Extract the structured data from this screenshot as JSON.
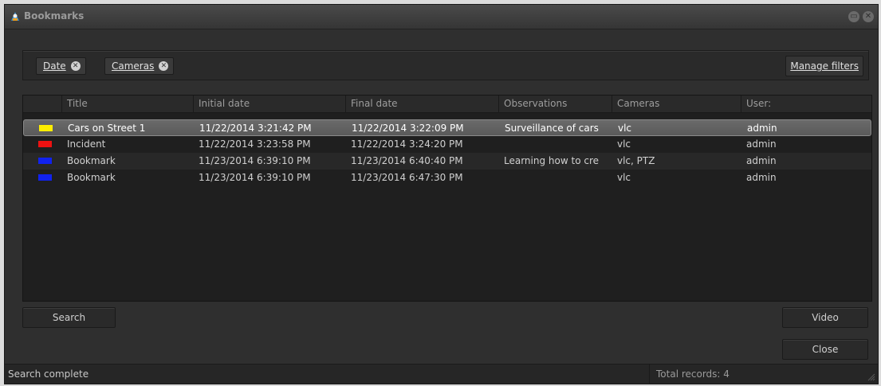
{
  "window": {
    "title": "Bookmarks"
  },
  "filters": {
    "chips": [
      {
        "label": "Date"
      },
      {
        "label": "Cameras"
      }
    ],
    "manage_label": "Manage filters"
  },
  "table": {
    "columns": [
      "",
      "Title",
      "Initial date",
      "Final date",
      "Observations",
      "Cameras",
      "User:"
    ],
    "rows": [
      {
        "color": "#ffee00",
        "title": "Cars on Street 1",
        "initial": "11/22/2014 3:21:42 PM",
        "final": "11/22/2014 3:22:09 PM",
        "observations": "Surveillance of cars",
        "cameras": "vlc",
        "user": "admin"
      },
      {
        "color": "#ee1111",
        "title": "Incident",
        "initial": "11/22/2014 3:23:58 PM",
        "final": "11/22/2014 3:24:20 PM",
        "observations": "",
        "cameras": "vlc",
        "user": "admin"
      },
      {
        "color": "#1122ee",
        "title": "Bookmark",
        "initial": "11/23/2014 6:39:10 PM",
        "final": "11/23/2014 6:40:40 PM",
        "observations": "Learning how to cre",
        "cameras": "vlc, PTZ",
        "user": "admin"
      },
      {
        "color": "#1122ee",
        "title": "Bookmark",
        "initial": "11/23/2014 6:39:10 PM",
        "final": "11/23/2014 6:47:30 PM",
        "observations": "",
        "cameras": "vlc",
        "user": "admin"
      }
    ]
  },
  "buttons": {
    "search": "Search",
    "video": "Video",
    "close": "Close"
  },
  "status": {
    "message": "Search complete",
    "total": "Total records: 4"
  }
}
